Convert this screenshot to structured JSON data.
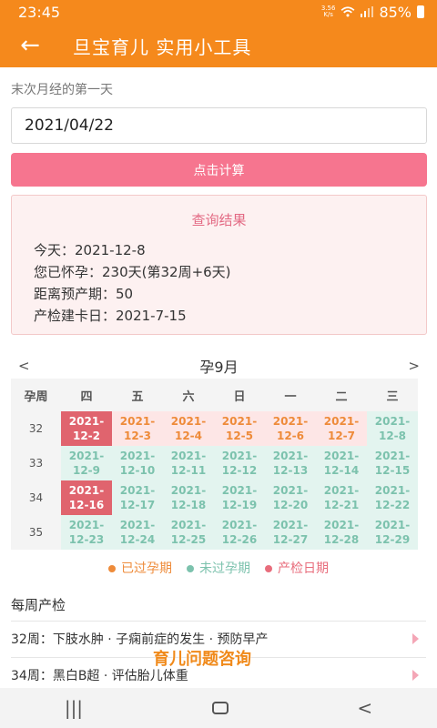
{
  "status": {
    "time": "23:45",
    "speed_value": "3.56",
    "speed_unit": "K/s",
    "battery": "85%"
  },
  "app_bar": {
    "back": "←",
    "title": "旦宝育儿 实用小工具"
  },
  "form": {
    "lmp_label": "末次月经的第一天",
    "lmp_value": "2021/04/22",
    "calc_button": "点击计算"
  },
  "result": {
    "title": "查询结果",
    "lines": [
      "今天：2021-12-8",
      "您已怀孕：230天(第32周+6天)",
      "距离预产期：50",
      "产检建卡日：2021-7-15"
    ]
  },
  "calendar": {
    "prev": "<",
    "next": ">",
    "month": "孕9月",
    "headers": [
      "孕周",
      "四",
      "五",
      "六",
      "日",
      "一",
      "二",
      "三"
    ],
    "rows": [
      {
        "week": "32",
        "cells": [
          {
            "y": "2021-",
            "d": "12-2",
            "s": "exam"
          },
          {
            "y": "2021-",
            "d": "12-3",
            "s": "past"
          },
          {
            "y": "2021-",
            "d": "12-4",
            "s": "past"
          },
          {
            "y": "2021-",
            "d": "12-5",
            "s": "past"
          },
          {
            "y": "2021-",
            "d": "12-6",
            "s": "past"
          },
          {
            "y": "2021-",
            "d": "12-7",
            "s": "past"
          },
          {
            "y": "2021-",
            "d": "12-8",
            "s": "future"
          }
        ]
      },
      {
        "week": "33",
        "cells": [
          {
            "y": "2021-",
            "d": "12-9",
            "s": "future"
          },
          {
            "y": "2021-",
            "d": "12-10",
            "s": "future"
          },
          {
            "y": "2021-",
            "d": "12-11",
            "s": "future"
          },
          {
            "y": "2021-",
            "d": "12-12",
            "s": "future"
          },
          {
            "y": "2021-",
            "d": "12-13",
            "s": "future"
          },
          {
            "y": "2021-",
            "d": "12-14",
            "s": "future"
          },
          {
            "y": "2021-",
            "d": "12-15",
            "s": "future"
          }
        ]
      },
      {
        "week": "34",
        "cells": [
          {
            "y": "2021-",
            "d": "12-16",
            "s": "exam"
          },
          {
            "y": "2021-",
            "d": "12-17",
            "s": "future"
          },
          {
            "y": "2021-",
            "d": "12-18",
            "s": "future"
          },
          {
            "y": "2021-",
            "d": "12-19",
            "s": "future"
          },
          {
            "y": "2021-",
            "d": "12-20",
            "s": "future"
          },
          {
            "y": "2021-",
            "d": "12-21",
            "s": "future"
          },
          {
            "y": "2021-",
            "d": "12-22",
            "s": "future"
          }
        ]
      },
      {
        "week": "35",
        "cells": [
          {
            "y": "2021-",
            "d": "12-23",
            "s": "future"
          },
          {
            "y": "2021-",
            "d": "12-24",
            "s": "future"
          },
          {
            "y": "2021-",
            "d": "12-25",
            "s": "future"
          },
          {
            "y": "2021-",
            "d": "12-26",
            "s": "future"
          },
          {
            "y": "2021-",
            "d": "12-27",
            "s": "future"
          },
          {
            "y": "2021-",
            "d": "12-28",
            "s": "future"
          },
          {
            "y": "2021-",
            "d": "12-29",
            "s": "future"
          }
        ]
      }
    ]
  },
  "legend": [
    {
      "label": "已过孕期",
      "color": "#ee8b3a"
    },
    {
      "label": "未过孕期",
      "color": "#7cc2ad"
    },
    {
      "label": "产检日期",
      "color": "#e86d7c"
    }
  ],
  "weekly": {
    "title": "每周产检",
    "items": [
      "32周：下肢水肿 · 子痫前症的发生 · 预防早产",
      "34周：黑白B超 · 评估胎儿体重"
    ]
  },
  "floating_link": "育儿问题咨询",
  "nav": {
    "recents": "|||",
    "back": "<"
  }
}
